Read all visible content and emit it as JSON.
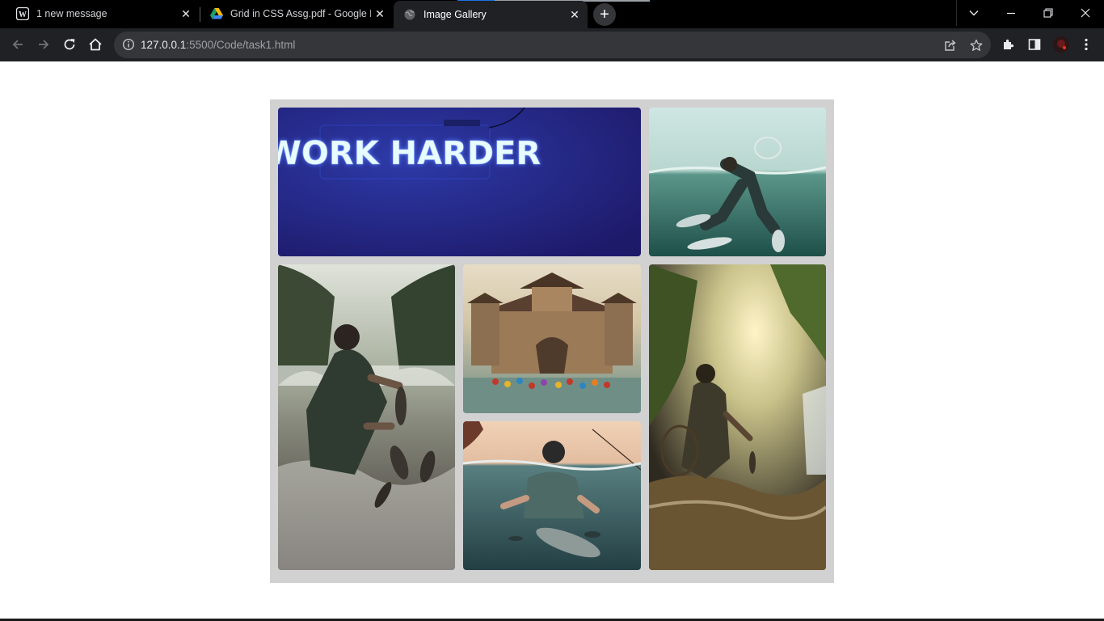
{
  "browser": {
    "tabs": [
      {
        "title": "1 new message",
        "state": "inactive",
        "icon": "wordpress-icon"
      },
      {
        "title": "Grid in CSS Assg.pdf - Google D",
        "state": "inactive",
        "icon": "google-drive-icon"
      },
      {
        "title": "Image Gallery",
        "state": "active",
        "icon": "globe-icon"
      }
    ],
    "new_tab_label": "+",
    "url_host": "127.0.0.1",
    "url_rest": ":5500/Code/task1.html",
    "colors": {
      "tabbar": "#000000",
      "toolbar": "#202124",
      "omnibox": "#35363a",
      "page_bg": "#ffffff",
      "gallery_bg": "#d1d1d1"
    }
  },
  "gallery": {
    "items": [
      {
        "name": "neon-sign-image",
        "sign_text": "WORK HARDER",
        "palette": {
          "bg": "#241f7e",
          "glow": "#4a63ff",
          "text": "#e8fbff"
        }
      },
      {
        "name": "underwater-fisher-image",
        "palette": {
          "sky": "#cfe6e2",
          "water": "#2f6b66"
        }
      },
      {
        "name": "river-fisherman-image",
        "palette": {
          "forest": "#3a4a3a",
          "water": "#a8a59a"
        }
      },
      {
        "name": "palace-festival-image",
        "palette": {
          "sky": "#dcd3bf",
          "stone": "#9a7a57"
        }
      },
      {
        "name": "diver-with-fish-image",
        "palette": {
          "sky": "#e9c9ad",
          "water": "#2d4f53"
        }
      },
      {
        "name": "waterfall-fisherman-image",
        "palette": {
          "light": "#f4e6b4",
          "forest": "#3e5224"
        }
      }
    ]
  }
}
